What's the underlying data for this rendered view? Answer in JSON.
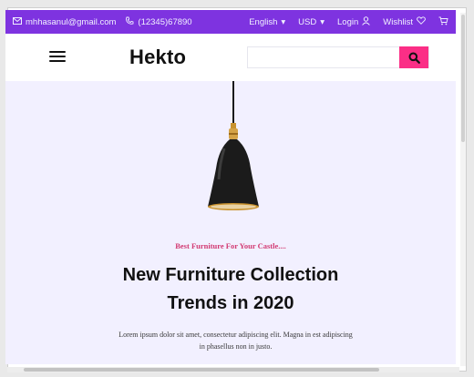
{
  "topbar": {
    "email": "mhhasanul@gmail.com",
    "email_icon": "mail-icon",
    "phone": "(12345)67890",
    "phone_icon": "phone-icon",
    "language": "English",
    "currency": "USD",
    "login": "Login",
    "login_icon": "user-icon",
    "wishlist": "Wishlist",
    "wishlist_icon": "heart-icon",
    "cart_icon": "cart-icon",
    "dropdown_glyph": "▾"
  },
  "header": {
    "brand": "Hekto",
    "menu_icon": "hamburger-icon",
    "search": {
      "placeholder": "",
      "value": ""
    },
    "search_icon": "search-icon"
  },
  "hero": {
    "subtitle": "Best Furniture For Your Castle....",
    "title_line1": "New Furniture Collection",
    "title_line2": "Trends in 2020",
    "description_line1": "Lorem ipsum dolor sit amet, consectetur adipiscing elit. Magna in est adipiscing",
    "description_line2": "in phasellus non in justo.",
    "image": "pendant-lamp-image"
  },
  "colors": {
    "topbar_bg": "#7e33e0",
    "accent_pink": "#fb2e86",
    "hero_bg": "#f2f0ff",
    "subtitle": "#d23a72"
  }
}
